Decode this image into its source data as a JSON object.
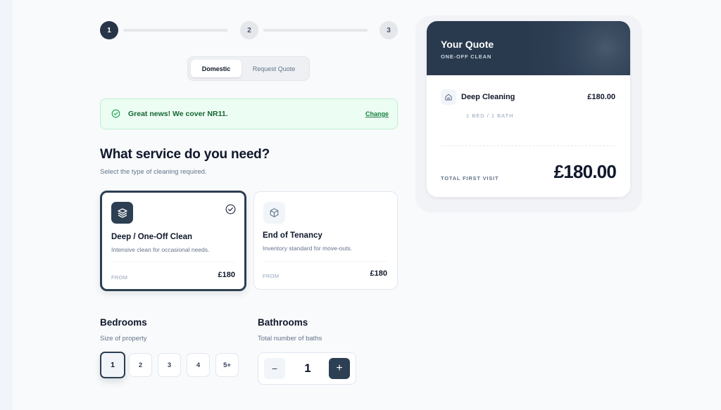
{
  "stepper": {
    "steps": [
      "1",
      "2",
      "3"
    ],
    "current_step": 1
  },
  "tabs": {
    "domestic_label": "Domestic",
    "request_quote_label": "Request Quote",
    "selected": "Domestic"
  },
  "coverage": {
    "message": "Great news! We cover NR11.",
    "change_label": "Change",
    "icon": "check-circle-icon"
  },
  "service": {
    "heading": "What service do you need?",
    "subheading": "Select the type of cleaning required.",
    "options": [
      {
        "title": "Deep / One-Off Clean",
        "description": "Intensive clean for occasional needs.",
        "from_label": "FROM",
        "price": "£180",
        "icon": "layers-icon",
        "selected": true
      },
      {
        "title": "End of Tenancy",
        "description": "Inventory standard for move-outs.",
        "from_label": "FROM",
        "price": "£180",
        "icon": "box-icon",
        "selected": false
      }
    ]
  },
  "bedrooms": {
    "title": "Bedrooms",
    "subtitle": "Size of property",
    "options": [
      "1",
      "2",
      "3",
      "4",
      "5+"
    ],
    "selected": "1"
  },
  "bathrooms": {
    "title": "Bathrooms",
    "subtitle": "Total number of baths",
    "value": "1",
    "minus": "−",
    "plus": "+"
  },
  "quote": {
    "title": "Your Quote",
    "subtitle": "ONE-OFF CLEAN",
    "item_name": "Deep Cleaning",
    "item_price": "£180.00",
    "item_meta": "1 BED / 1 BATH",
    "total_label": "TOTAL FIRST VISIT",
    "total": "£180.00"
  },
  "colors": {
    "primary": "#2d3f52",
    "success_bg": "#ecfdf3",
    "success_text": "#166534"
  }
}
